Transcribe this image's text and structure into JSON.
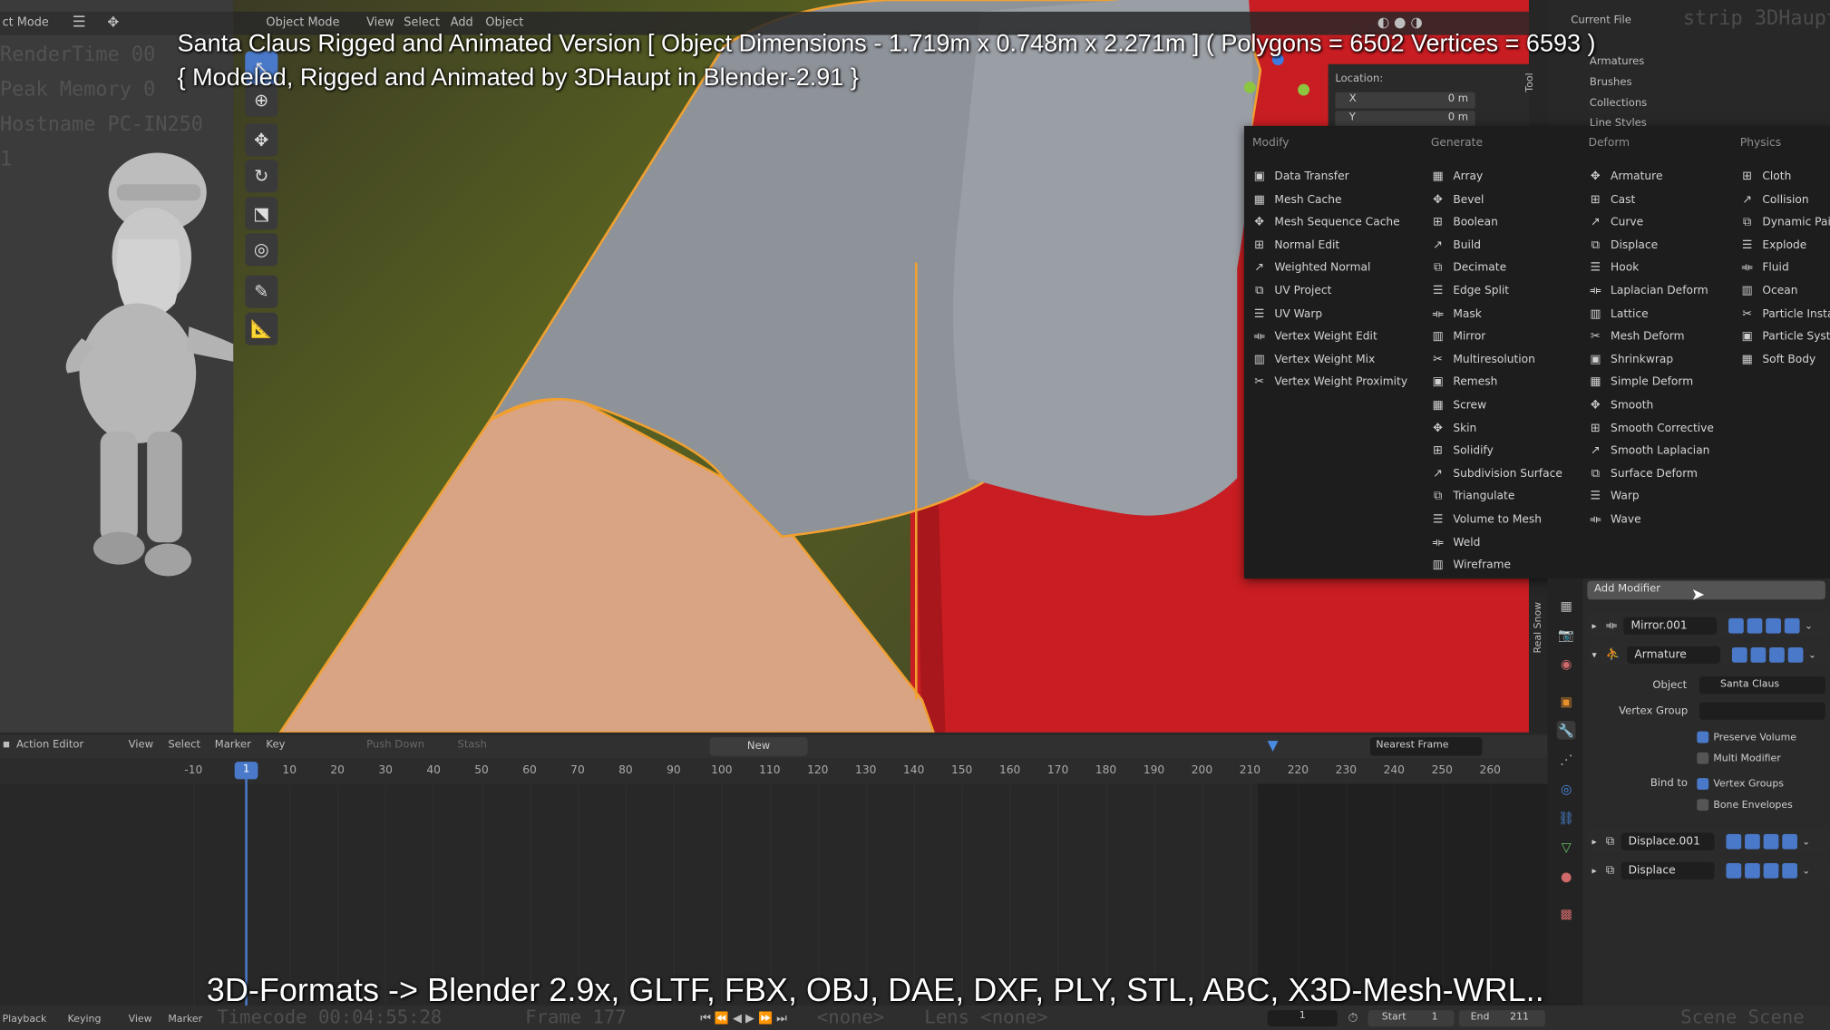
{
  "overlay": {
    "title_line1": "Santa Claus Rigged and Animated Version [ Object Dimensions -  1.719m x 0.748m x 2.271m ] ( Polygons = 6502  Vertices = 6593 )",
    "title_line2": "{ Modeled, Rigged and Animated by 3DHaupt in Blender-2.91 }",
    "formats": "3D-Formats -> Blender 2.9x, GLTF, FBX, OBJ, DAE, DXF, PLY, STL, ABC, X3D-Mesh-WRL.."
  },
  "left_panel": {
    "mode": "ct Mode",
    "render_stats": [
      "RenderTime 00",
      "Peak Memory 0",
      "Hostname PC-IN250",
      "1"
    ]
  },
  "viewport": {
    "mode": "Object Mode",
    "menu": [
      "View",
      "Select",
      "Add",
      "Object"
    ],
    "location_label": "Location:",
    "loc_x_label": "X",
    "loc_x_value": "0 m",
    "loc_y_label": "Y",
    "loc_y_value": "0 m",
    "item_tab": "Tool"
  },
  "modifier_menu": {
    "columns": [
      {
        "header": "Modify",
        "items": [
          "Data Transfer",
          "Mesh Cache",
          "Mesh Sequence Cache",
          "Normal Edit",
          "Weighted Normal",
          "UV Project",
          "UV Warp",
          "Vertex Weight Edit",
          "Vertex Weight Mix",
          "Vertex Weight Proximity"
        ]
      },
      {
        "header": "Generate",
        "items": [
          "Array",
          "Bevel",
          "Boolean",
          "Build",
          "Decimate",
          "Edge Split",
          "Mask",
          "Mirror",
          "Multiresolution",
          "Remesh",
          "Screw",
          "Skin",
          "Solidify",
          "Subdivision Surface",
          "Triangulate",
          "Volume to Mesh",
          "Weld",
          "Wireframe"
        ]
      },
      {
        "header": "Deform",
        "items": [
          "Armature",
          "Cast",
          "Curve",
          "Displace",
          "Hook",
          "Laplacian Deform",
          "Lattice",
          "Mesh Deform",
          "Shrinkwrap",
          "Simple Deform",
          "Smooth",
          "Smooth Corrective",
          "Smooth Laplacian",
          "Surface Deform",
          "Warp",
          "Wave"
        ]
      },
      {
        "header": "Physics",
        "items": [
          "Cloth",
          "Collision",
          "Dynamic Pai",
          "Explode",
          "Fluid",
          "Ocean",
          "Particle Insta",
          "Particle Syste",
          "Soft Body"
        ]
      }
    ]
  },
  "outliner": {
    "header": "Current File",
    "items": [
      "Armatures",
      "Brushes",
      "Collections",
      "Line Styles"
    ],
    "ghost_text": "strip 3DHaupt"
  },
  "properties": {
    "add_modifier": "Add Modifier",
    "side_tab": "Real Snow",
    "modifiers": [
      {
        "name": "Mirror.001"
      },
      {
        "name": "Armature"
      },
      {
        "name": "Displace.001"
      },
      {
        "name": "Displace"
      }
    ],
    "armature": {
      "object_label": "Object",
      "object_value": "Santa Claus",
      "vgroup_label": "Vertex Group",
      "preserve_volume": "Preserve Volume",
      "multi_modifier": "Multi Modifier",
      "bind_to_label": "Bind to",
      "vertex_groups": "Vertex Groups",
      "bone_envelopes": "Bone Envelopes"
    }
  },
  "timeline": {
    "editor": "Action Editor",
    "menu": [
      "View",
      "Select",
      "Marker",
      "Key"
    ],
    "push_down": "Push Down",
    "stash": "Stash",
    "new_btn": "New",
    "snap": "Nearest Frame",
    "current_frame": "1",
    "ticks": [
      "-10",
      "10",
      "20",
      "30",
      "40",
      "50",
      "60",
      "70",
      "80",
      "90",
      "100",
      "110",
      "120",
      "130",
      "140",
      "150",
      "160",
      "170",
      "180",
      "190",
      "200",
      "210",
      "220",
      "230",
      "240",
      "250",
      "260"
    ],
    "bottom_menu": [
      "Playback",
      "Keying",
      "View",
      "Marker"
    ],
    "bottom_frame": "1",
    "start_label": "Start",
    "start_value": "1",
    "end_label": "End",
    "end_value": "211",
    "ghost_timecode": "Timecode 00:04:55:28",
    "ghost_frame": "Frame 177",
    "ghost_none": "<none>",
    "ghost_lens": "Lens <none>",
    "ghost_scene": "Scene Scene"
  },
  "colors": {
    "accent_blue": "#4a79c9",
    "santa_red": "#cc1f24",
    "sleeve_grey": "#8e9299",
    "skin": "#d9a484",
    "outline_orange": "#f0a030"
  }
}
